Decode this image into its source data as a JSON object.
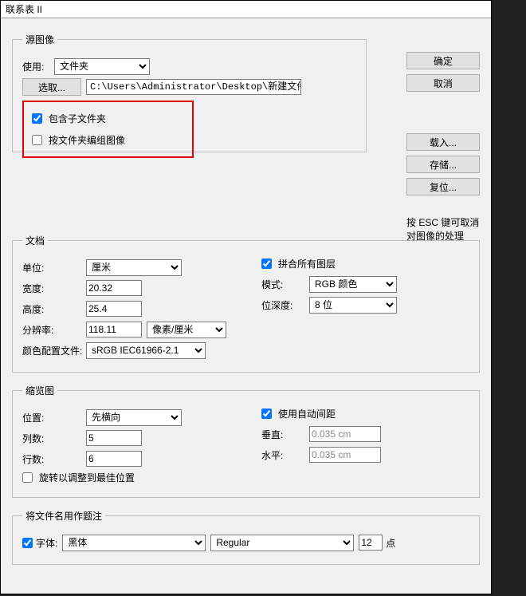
{
  "title": "联系表 II",
  "buttons": {
    "ok": "确定",
    "cancel": "取消",
    "load": "载入...",
    "save": "存储...",
    "reset": "复位..."
  },
  "hint": "按 ESC 键可取消对图像的处理",
  "source": {
    "legend": "源图像",
    "use_label": "使用:",
    "use_value": "文件夹",
    "browse": "选取...",
    "path": "C:\\Users\\Administrator\\Desktop\\新建文件夹",
    "include_sub": "包含子文件夹",
    "group_by_folder": "按文件夹编组图像",
    "include_sub_checked": true,
    "group_by_folder_checked": false
  },
  "doc": {
    "legend": "文档",
    "unit_label": "单位:",
    "unit_value": "厘米",
    "width_label": "宽度:",
    "width_value": "20.32",
    "height_label": "高度:",
    "height_value": "25.4",
    "res_label": "分辨率:",
    "res_value": "118.11",
    "res_unit": "像素/厘米",
    "profile_label": "颜色配置文件:",
    "profile_value": "sRGB IEC61966-2.1",
    "flatten": "拼合所有图层",
    "flatten_checked": true,
    "mode_label": "模式:",
    "mode_value": "RGB 颜色",
    "depth_label": "位深度:",
    "depth_value": "8 位"
  },
  "thumb": {
    "legend": "缩览图",
    "place_label": "位置:",
    "place_value": "先横向",
    "cols_label": "列数:",
    "cols_value": "5",
    "rows_label": "行数:",
    "rows_value": "6",
    "rotate": "旋转以调整到最佳位置",
    "rotate_checked": false,
    "auto_spacing": "使用自动间距",
    "auto_spacing_checked": true,
    "vert_label": "垂直:",
    "vert_value": "0.035 cm",
    "horiz_label": "水平:",
    "horiz_value": "0.035 cm"
  },
  "caption": {
    "legend": "将文件名用作题注",
    "font_label": "字体:",
    "font_checked": true,
    "font_family": "黑体",
    "font_style": "Regular",
    "font_size": "12",
    "pt": "点"
  }
}
